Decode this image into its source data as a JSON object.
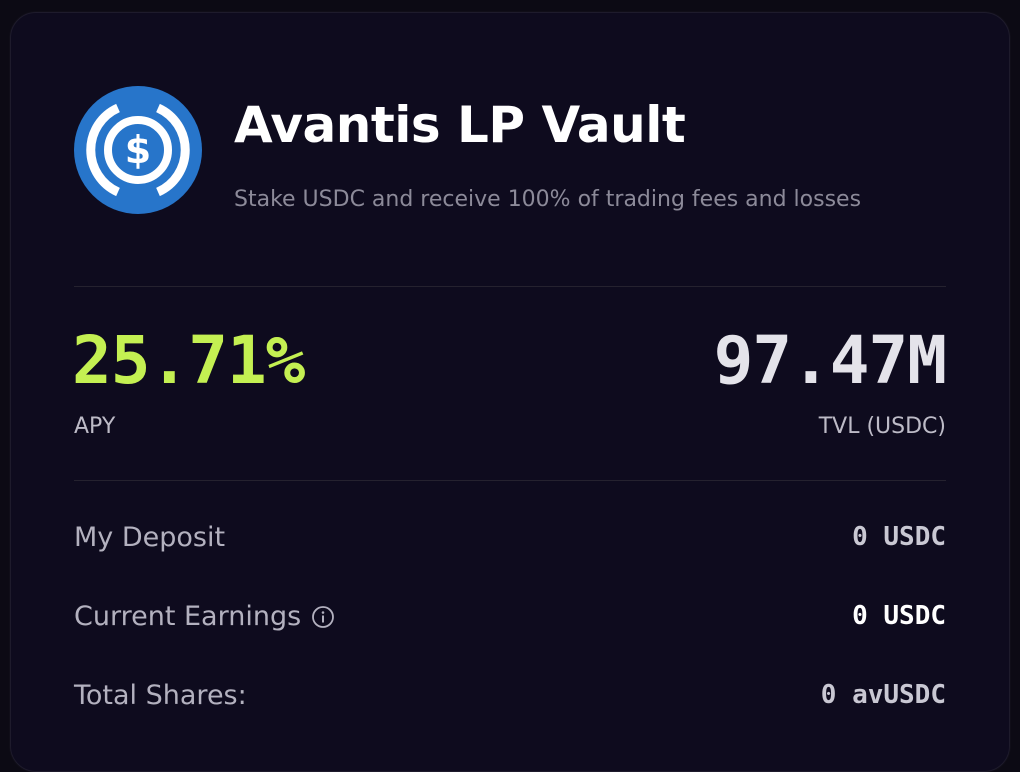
{
  "vault": {
    "title": "Avantis LP Vault",
    "subtitle": "Stake USDC and receive 100% of trading fees and losses",
    "logo_icon": "usdc-coin-icon",
    "logo_color": "#2775ca"
  },
  "stats": {
    "apy_value": "25.71%",
    "apy_label": "APY",
    "apy_color": "#c4f052",
    "tvl_value": "97.47M",
    "tvl_label": "TVL (USDC)"
  },
  "rows": [
    {
      "label": "My Deposit",
      "value": "0 USDC"
    },
    {
      "label": "Current Earnings",
      "value": "0 USDC",
      "icon": "info-icon"
    },
    {
      "label": "Total Shares:",
      "value": "0 avUSDC"
    }
  ]
}
